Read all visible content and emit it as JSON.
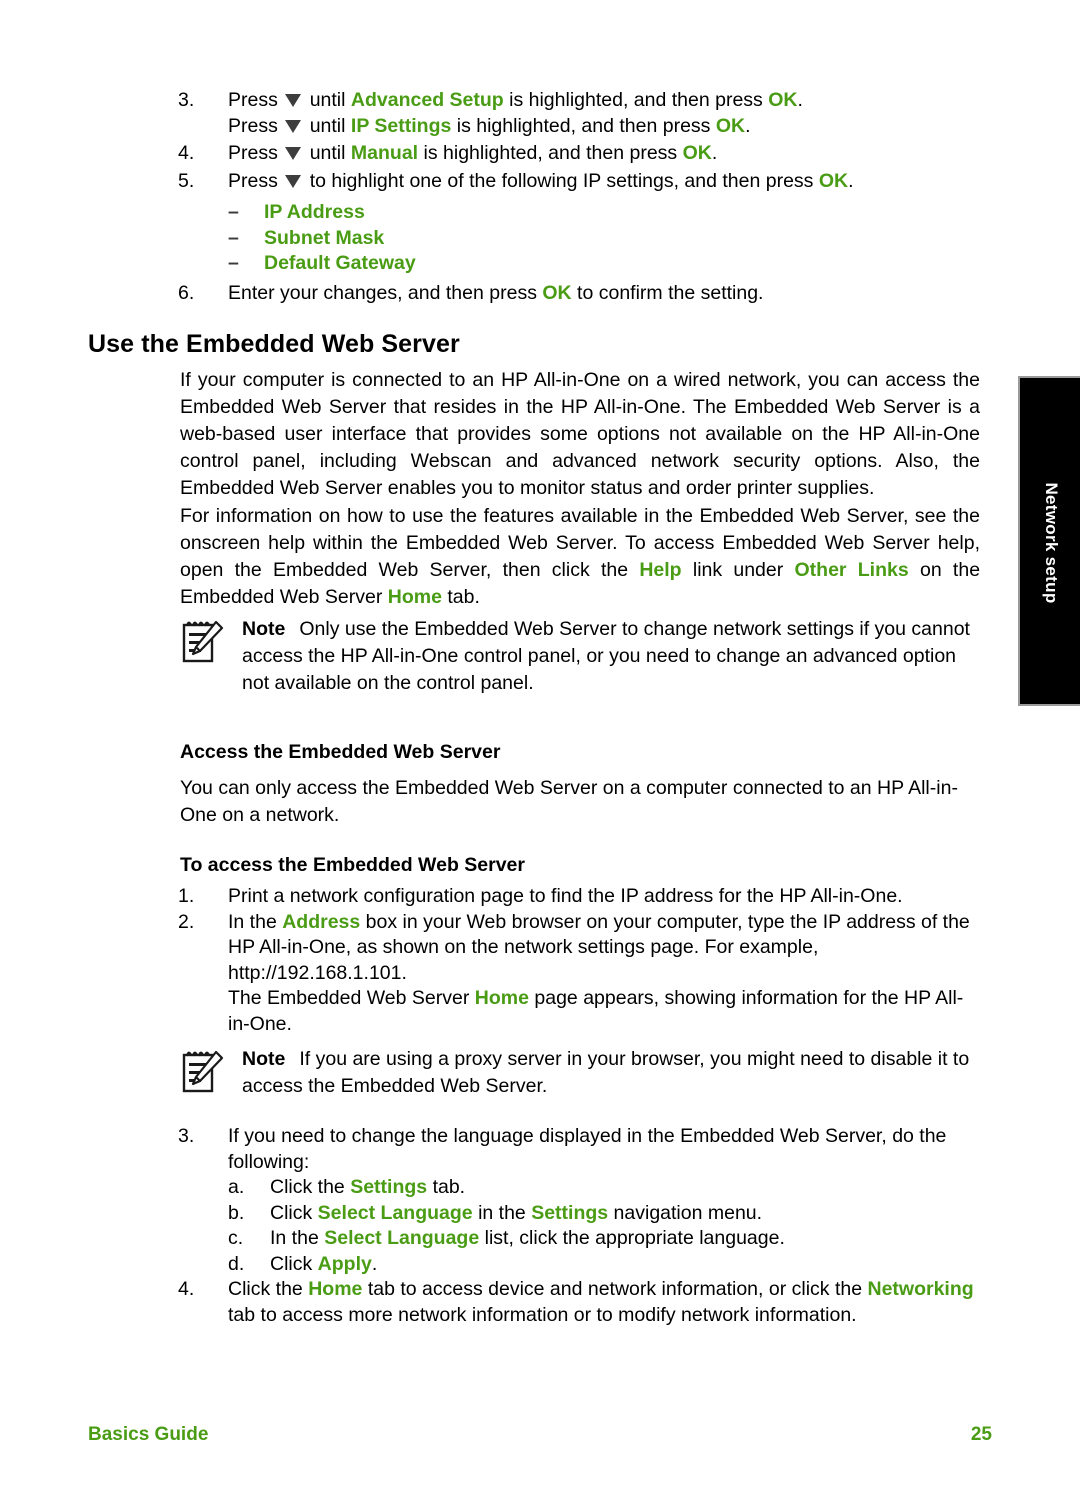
{
  "colors": {
    "accent_green": "#4a9c15",
    "text_black": "#000000",
    "tab_black": "#000000",
    "tab_text": "#ffffff"
  },
  "steps_top": {
    "step3": {
      "num": "3.",
      "l1_a": "Press",
      "l1_b": "until",
      "l1_key": "Advanced Setup",
      "l1_c": "is highlighted, and then press",
      "l1_ok": "OK",
      "l1_d": ".",
      "l2_a": "Press",
      "l2_b": "until",
      "l2_key": "IP Settings",
      "l2_c": "is highlighted, and then press",
      "l2_ok": "OK",
      "l2_d": "."
    },
    "step4": {
      "num": "4.",
      "a": "Press",
      "b": "until",
      "key": "Manual",
      "c": "is highlighted, and then press",
      "ok": "OK",
      "d": "."
    },
    "step5": {
      "num": "5.",
      "a": "Press",
      "b": "to highlight one of the following IP settings, and then press",
      "ok": "OK",
      "c": ".",
      "options": [
        "IP Address",
        "Subnet Mask",
        "Default Gateway"
      ],
      "dash": "–"
    },
    "step6": {
      "num": "6.",
      "a": "Enter your changes, and then press",
      "ok": "OK",
      "b": "to confirm the setting."
    }
  },
  "section": {
    "heading": "Use the Embedded Web Server",
    "para1": "If your computer is connected to an HP All-in-One on a wired network, you can access the Embedded Web Server that resides in the HP All-in-One. The Embedded Web Server is a web-based user interface that provides some options not available on the HP All-in-One control panel, including Webscan and advanced network security options. Also, the Embedded Web Server enables you to monitor status and order printer supplies.",
    "para2_a": "For information on how to use the features available in the Embedded Web Server, see the onscreen help within the Embedded Web Server. To access Embedded Web Server help, open the Embedded Web Server, then click the",
    "para2_help": "Help",
    "para2_b": "link under",
    "para2_other": "Other Links",
    "para2_c": "on the Embedded Web Server",
    "para2_home": "Home",
    "para2_d": "tab."
  },
  "note1": {
    "icon": "note-pad-pencil-icon",
    "label": "Note",
    "text": "Only use the Embedded Web Server to change network settings if you cannot access the HP All-in-One control panel, or you need to change an advanced option not available on the control panel."
  },
  "access": {
    "heading": "Access the Embedded Web Server",
    "para": "You can only access the Embedded Web Server on a computer connected to an HP All-in-One on a network.",
    "subheading": "To access the Embedded Web Server"
  },
  "steps_access": {
    "step1": {
      "num": "1.",
      "text": "Print a network configuration page to find the IP address for the HP All-in-One."
    },
    "step2": {
      "num": "2.",
      "a": "In the",
      "key": "Address",
      "b": "box in your Web browser on your computer, type the IP address of the HP All-in-One, as shown on the network settings page. For example, http://192.168.1.101.",
      "cont_a": "The Embedded Web Server",
      "cont_home": "Home",
      "cont_b": "page appears, showing information for the HP All-in-One."
    }
  },
  "note2": {
    "icon": "note-pad-pencil-icon",
    "label": "Note",
    "text": "If you are using a proxy server in your browser, you might need to disable it to access the Embedded Web Server."
  },
  "steps_lang": {
    "step3": {
      "num": "3.",
      "text": "If you need to change the language displayed in the Embedded Web Server, do the following:",
      "sub": [
        {
          "letter": "a.",
          "pre": "Click the",
          "key": "Settings",
          "post": "tab."
        },
        {
          "letter": "b.",
          "pre": "Click",
          "key": "Select Language",
          "mid": "in the",
          "key2": "Settings",
          "post": "navigation menu."
        },
        {
          "letter": "c.",
          "pre": "In the",
          "key": "Select Language",
          "post": "list, click the appropriate language."
        },
        {
          "letter": "d.",
          "pre": "Click",
          "key": "Apply",
          "post": "."
        }
      ]
    },
    "step4": {
      "num": "4.",
      "a": "Click the",
      "key_home": "Home",
      "b": "tab to access device and network information, or click the",
      "key_net": "Networking",
      "c": "tab to access more network information or to modify network information."
    }
  },
  "sidetab": {
    "label": "Network setup"
  },
  "footer": {
    "guide": "Basics Guide",
    "page_number": "25"
  }
}
